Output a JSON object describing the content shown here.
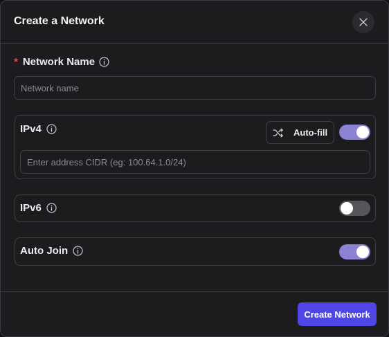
{
  "dialog": {
    "title": "Create a Network",
    "close_icon": "close-icon"
  },
  "network_name": {
    "required_marker": "*",
    "label": "Network Name",
    "info_icon": "info-icon",
    "placeholder": "Network name",
    "value": ""
  },
  "ipv4": {
    "label": "IPv4",
    "info_icon": "info-icon",
    "autofill_label": "Auto-fill",
    "autofill_icon": "shuffle-icon",
    "enabled": true,
    "cidr_placeholder": "Enter address CIDR (eg: 100.64.1.0/24)",
    "cidr_value": ""
  },
  "ipv6": {
    "label": "IPv6",
    "info_icon": "info-icon",
    "enabled": false
  },
  "auto_join": {
    "label": "Auto Join",
    "info_icon": "info-icon",
    "enabled": true
  },
  "footer": {
    "create_label": "Create Network"
  },
  "colors": {
    "accent": "#4f46e5",
    "toggle_on": "#8b82d4",
    "toggle_off": "#55555b",
    "required": "#e5484d",
    "background": "#1c1c1f",
    "border": "#3f3f46"
  }
}
